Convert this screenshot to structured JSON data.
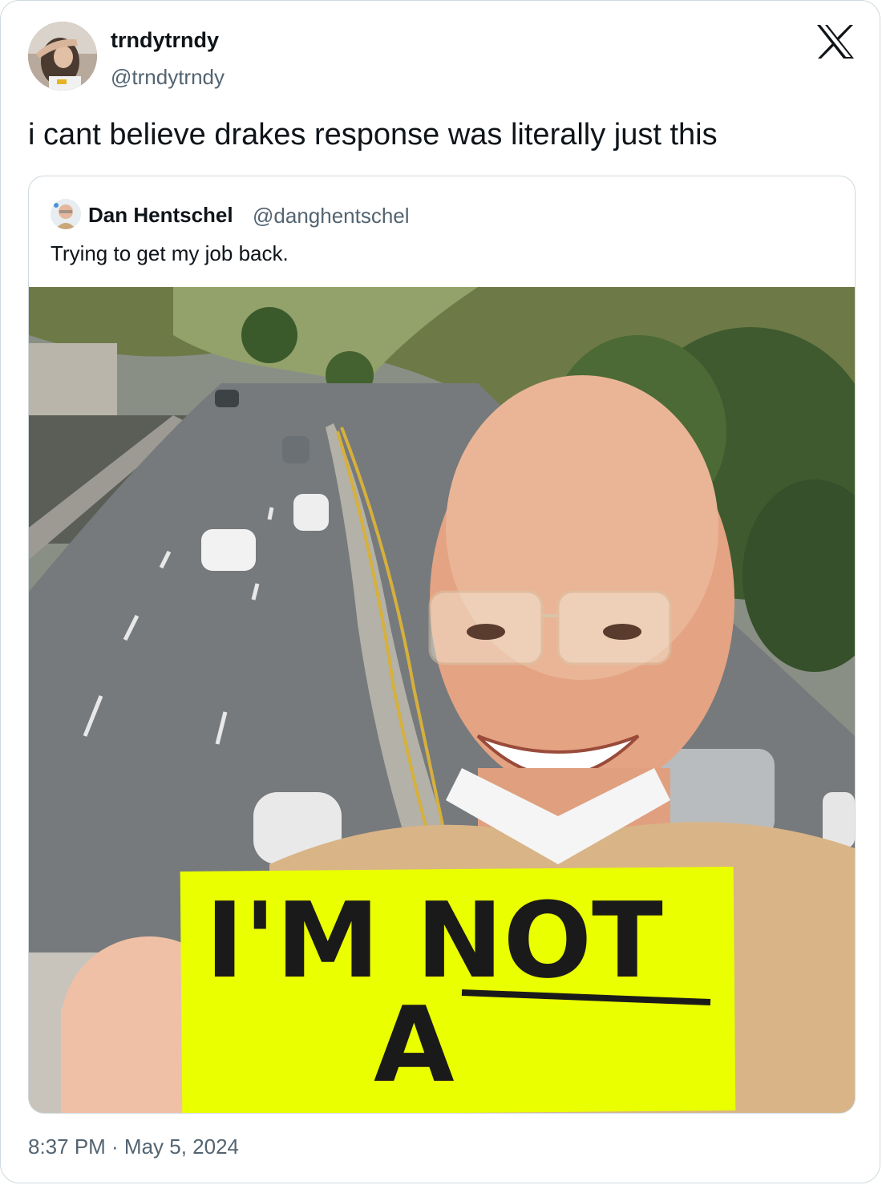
{
  "author": {
    "name": "trndytrndy",
    "handle": "@trndytrndy",
    "avatar_icon": "profile-photo"
  },
  "tweet": {
    "text": "i cant believe drakes response was literally just this",
    "timestamp": "8:37 PM · May 5, 2024"
  },
  "quoted_tweet": {
    "name": "Dan Hentschel",
    "handle": "@danghentschel",
    "text": "Trying to get my job back.",
    "avatar_icon": "profile-photo",
    "image": {
      "sign_lines": [
        "I'M NOT",
        "A"
      ],
      "description_icon": "selfie-photo"
    }
  },
  "brand": {
    "logo_icon": "x-logo-icon"
  },
  "colors": {
    "text": "#0f1419",
    "secondary": "#536471",
    "border": "#cfd9de",
    "sign": "#eaff00"
  }
}
